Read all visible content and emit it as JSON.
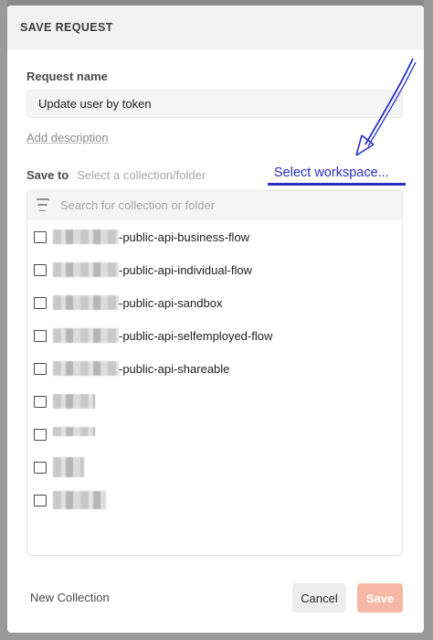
{
  "modal": {
    "title": "SAVE REQUEST"
  },
  "request_name": {
    "label": "Request name",
    "value": "Update user by token",
    "add_description": "Add description"
  },
  "save_to": {
    "label": "Save to",
    "path_placeholder": "Select a collection/folder",
    "workspace_link": "Select workspace...",
    "annotation_color": "#2b2ec6"
  },
  "collections": {
    "search_placeholder": "Search for collection or folder",
    "items": [
      {
        "suffix": "-public-api-business-flow"
      },
      {
        "suffix": "-public-api-individual-flow"
      },
      {
        "suffix": "-public-api-sandbox"
      },
      {
        "suffix": "-public-api-selfemployed-flow"
      },
      {
        "suffix": "-public-api-shareable"
      },
      {
        "suffix": ""
      },
      {
        "suffix": ""
      },
      {
        "suffix": ""
      },
      {
        "suffix": ""
      }
    ],
    "icon": "collection-folder-icon"
  },
  "footer": {
    "new_collection": "New Collection",
    "cancel": "Cancel",
    "save": "Save"
  },
  "colors": {
    "save_button": "#f6b8a4",
    "header_bg": "#f2f2f2"
  }
}
